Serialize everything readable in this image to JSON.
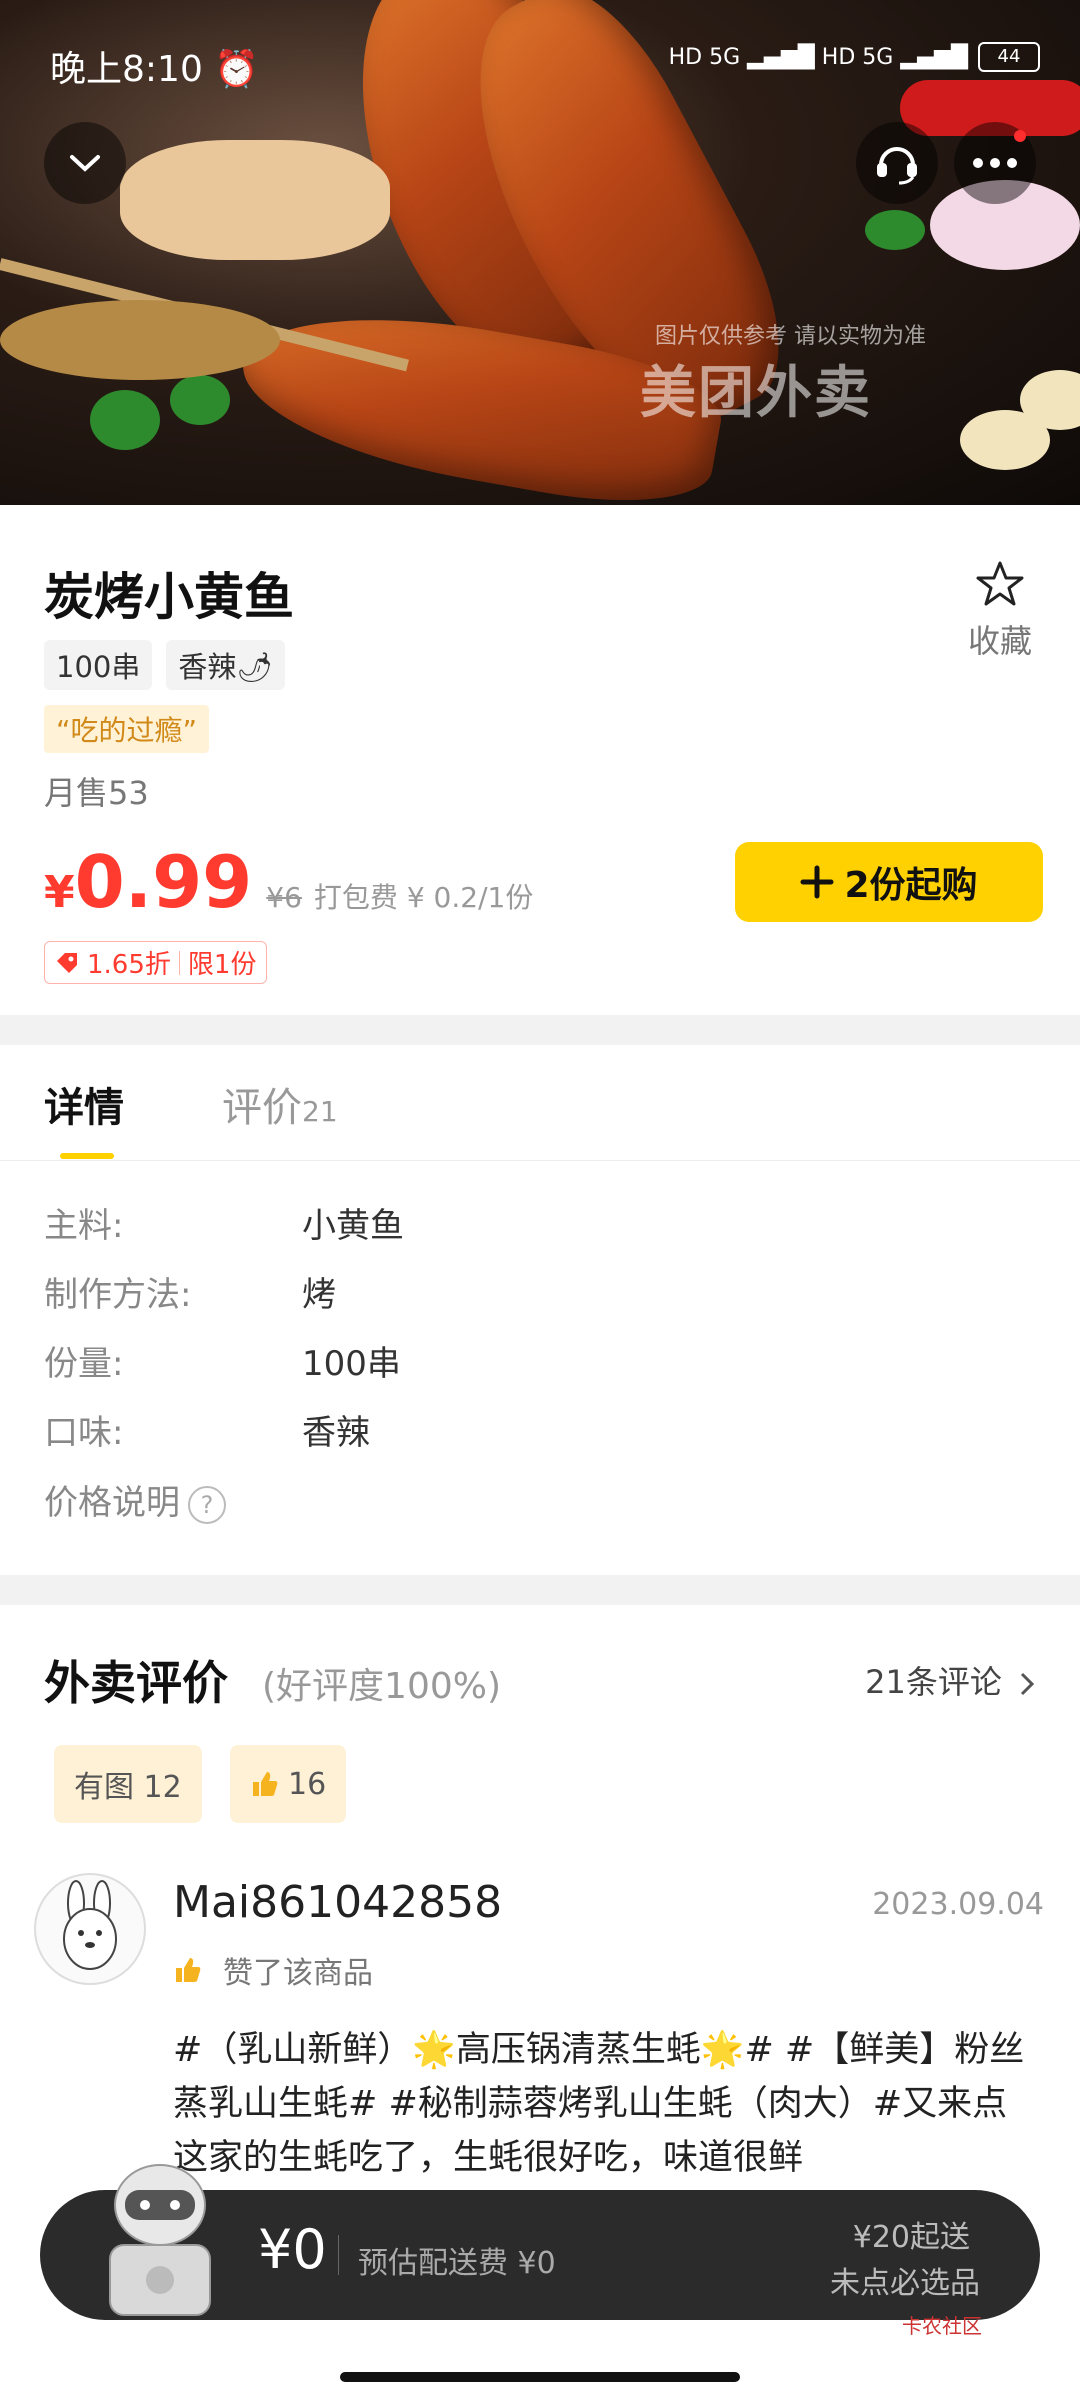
{
  "status_bar": {
    "time": "晚上8:10",
    "alarm": "⏰",
    "signal": "HD 5G ▂▄▆█ HD 5G ▂▄▆█",
    "battery": "44"
  },
  "hero": {
    "watermark": "美团外卖",
    "note": "图片仅供参考 请以实物为准"
  },
  "product": {
    "title": "炭烤小黄鱼",
    "favorite_label": "收藏",
    "tags": [
      "100串",
      "香辣🌶"
    ],
    "quote": "“吃的过瘾”",
    "sales": "月售53",
    "price_symbol": "¥",
    "price": "0.99",
    "original_price": "¥6",
    "packing_fee": "打包费 ¥ 0.2/1份",
    "buy_label": "2份起购",
    "discount": "1.65折",
    "limit": "限1份"
  },
  "details": {
    "tabs": [
      {
        "label": "详情"
      },
      {
        "label": "评价",
        "count": "21"
      }
    ],
    "rows": [
      {
        "key": "主料:",
        "value": "小黄鱼"
      },
      {
        "key": "制作方法:",
        "value": "烤"
      },
      {
        "key": "份量:",
        "value": "100串"
      },
      {
        "key": "口味:",
        "value": "香辣"
      }
    ],
    "price_note": "价格说明"
  },
  "reviews": {
    "title": "外卖评价",
    "rate": "(好评度100%)",
    "count": "21条评论",
    "chips": [
      {
        "label": "有图 12"
      },
      {
        "label": "16"
      }
    ],
    "item": {
      "username": "Mai861042858",
      "date": "2023.09.04",
      "liked": "赞了该商品",
      "text": "#（乳山新鲜）🌟高压锅清蒸生蚝🌟# #【鲜美】粉丝蒸乳山生蚝# #秘制蒜蓉烤乳山生蚝（肉大）#又来点这家的生蚝吃了，生蚝很好吃，味道很鲜"
    }
  },
  "cart": {
    "price": "¥0",
    "fee": "预估配送费 ¥0",
    "min": "¥20起送",
    "required": "未点必选品"
  },
  "watermark_badge": "卡农社区"
}
